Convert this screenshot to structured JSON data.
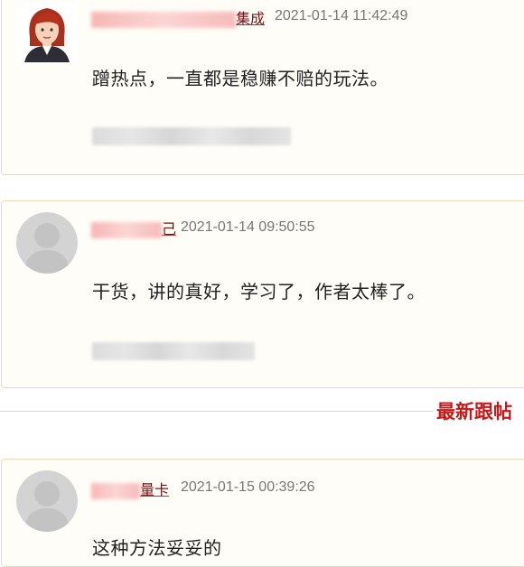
{
  "posts": [
    {
      "username_visible": "集成",
      "timestamp": "2021-01-14 11:42:49",
      "comment": "蹭热点，一直都是稳赚不赔的玩法。"
    },
    {
      "username_visible": "己",
      "timestamp": "2021-01-14 09:50:55",
      "comment": "干货，讲的真好，学习了，作者太棒了。"
    },
    {
      "username_visible": "量卡",
      "timestamp": "2021-01-15 00:39:26",
      "comment": "这种方法妥妥的"
    }
  ],
  "section": {
    "latest_replies_label": "最新跟帖"
  },
  "colors": {
    "accent_red": "#c41a1a",
    "username": "#7a1010",
    "card_border": "#ecd9b8",
    "card_bg": "#fffdf7"
  },
  "icons": {
    "avatar_1": "female-avatar",
    "avatar_2": "default-user-avatar",
    "avatar_3": "default-user-avatar"
  }
}
